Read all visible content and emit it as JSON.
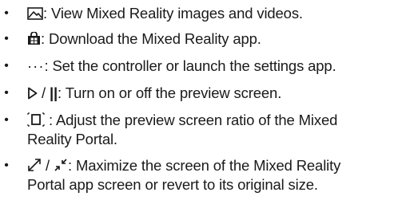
{
  "items": [
    {
      "icon": "image-gallery-icon",
      "text": ": View Mixed Reality images and videos."
    },
    {
      "icon": "store-bag-icon",
      "text": ": Download the Mixed Reality app."
    },
    {
      "icon": "more-dots-icon",
      "icon_glyph": "···",
      "text": ": Set the controller or launch the settings app."
    },
    {
      "icon": "play-icon",
      "separator": " / ",
      "icon2": "pause-icon",
      "icon2_glyph": "||",
      "text": ": Turn on or off the preview screen."
    },
    {
      "icon": "aspect-ratio-icon",
      "text": " : Adjust the preview screen ratio of the Mixed",
      "text_line2": "Reality Portal."
    },
    {
      "icon": "maximize-icon",
      "separator": " / ",
      "icon2": "restore-icon",
      "text": ": Maximize the screen of the Mixed Reality",
      "text_line2": "Portal app screen or revert to its original size."
    }
  ],
  "bullet_glyph": "•"
}
